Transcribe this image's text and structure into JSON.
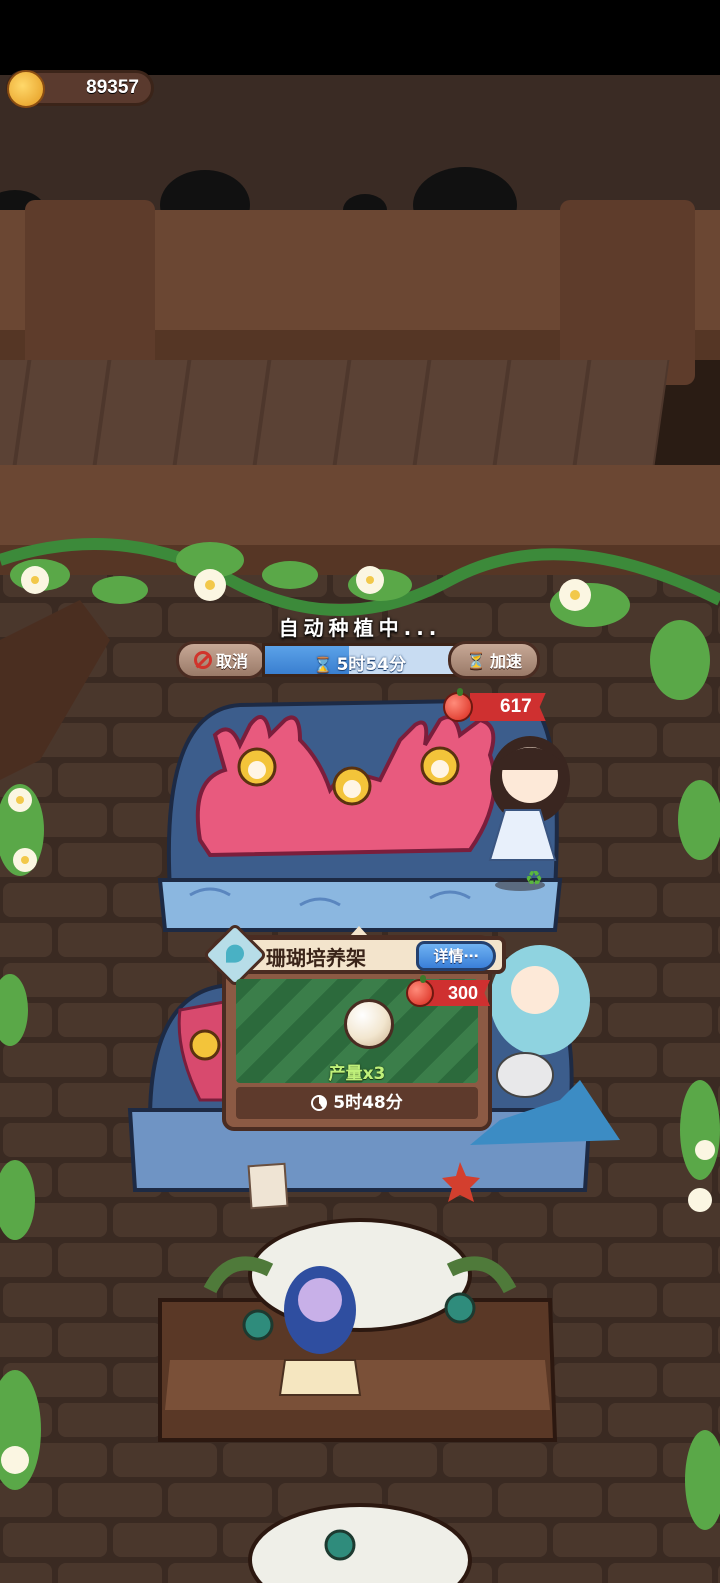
{
  "hud": {
    "coins": "89357",
    "coin_icon": "crown-coin-icon"
  },
  "planting": {
    "status": "自动种植中...",
    "timer": "5时54分",
    "timer_progress": 0.44,
    "cancel_label": "取消",
    "speed_label": "加速",
    "apple_count": "617"
  },
  "building_card": {
    "title": "珊瑚培养架",
    "detail_label": "详情⋯",
    "cost": "300",
    "yield": "产量x3",
    "time": "5时48分"
  },
  "colors": {
    "accent_blue": "#3a7fd0",
    "apple_red": "#cf3030",
    "yield_green": "#bff07a"
  }
}
